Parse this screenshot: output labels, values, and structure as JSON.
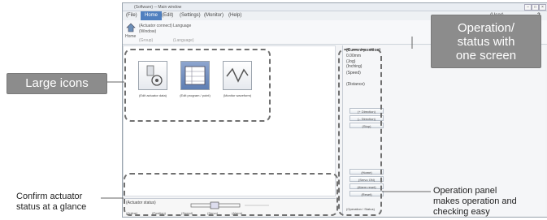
{
  "window": {
    "title": "(Software) ─ Main window",
    "help_label": "?",
    "user_label": "(User)"
  },
  "menubar": {
    "items": [
      "(File)",
      "Home",
      "(Edit)",
      "(Settings)",
      "(Monitor)",
      "(Help)"
    ]
  },
  "ribbon": {
    "home_label": "Home",
    "group_labels": [
      "(Actuator connect)",
      "(Window)",
      "(Language)"
    ],
    "language_label": "Language",
    "group_caption": "(Group)"
  },
  "big_icons": [
    {
      "icon": "actuator-gear-icon",
      "label": "(Edit actuator data)"
    },
    {
      "icon": "point-list-icon",
      "label": "(Edit program / point)"
    },
    {
      "icon": "waveform-monitor-icon",
      "label": "(Monitor waveform)"
    }
  ],
  "sidepanel": {
    "title": "(Current position)",
    "position_value": "0.00mm",
    "items": [
      "(Jog)",
      "(Inching)",
      "(Speed)",
      "(Distance)"
    ],
    "buttons": [
      "(+ Direction)",
      "(– Direction)",
      "(Stop)",
      "(Home)",
      "(Servo ON)",
      "(Alarm reset)",
      "(Reset)"
    ],
    "footer": "(Operation / Status)"
  },
  "status_area": {
    "title": "(Actuator status)",
    "tabs": [
      "(Online)",
      "(Position)",
      "(Speed)",
      "(Servo)",
      "(Alarm)"
    ]
  },
  "callouts": {
    "large_icons": "Large icons",
    "operation_status_l1": "Operation/",
    "operation_status_l2": "status with",
    "operation_status_l3": "one screen",
    "confirm_l1": "Confirm actuator",
    "confirm_l2": "status at a glance",
    "operation_panel_l1": "Operation panel",
    "operation_panel_l2": "makes operation and",
    "operation_panel_l3": "checking easy"
  }
}
